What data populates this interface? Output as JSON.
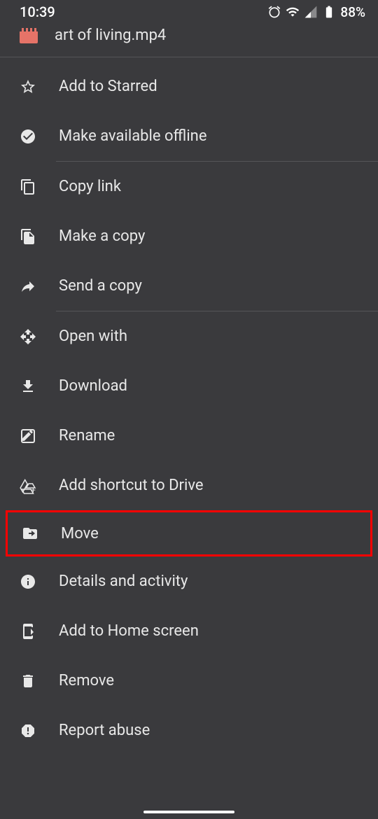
{
  "statusBar": {
    "time": "10:39",
    "battery": "88%"
  },
  "file": {
    "name": "art of living.mp4"
  },
  "menu": {
    "starred": "Add to Starred",
    "offline": "Make available offline",
    "copyLink": "Copy link",
    "makeCopy": "Make a copy",
    "sendCopy": "Send a copy",
    "openWith": "Open with",
    "download": "Download",
    "rename": "Rename",
    "addShortcut": "Add shortcut to Drive",
    "move": "Move",
    "details": "Details and activity",
    "addHome": "Add to Home screen",
    "remove": "Remove",
    "reportAbuse": "Report abuse"
  }
}
